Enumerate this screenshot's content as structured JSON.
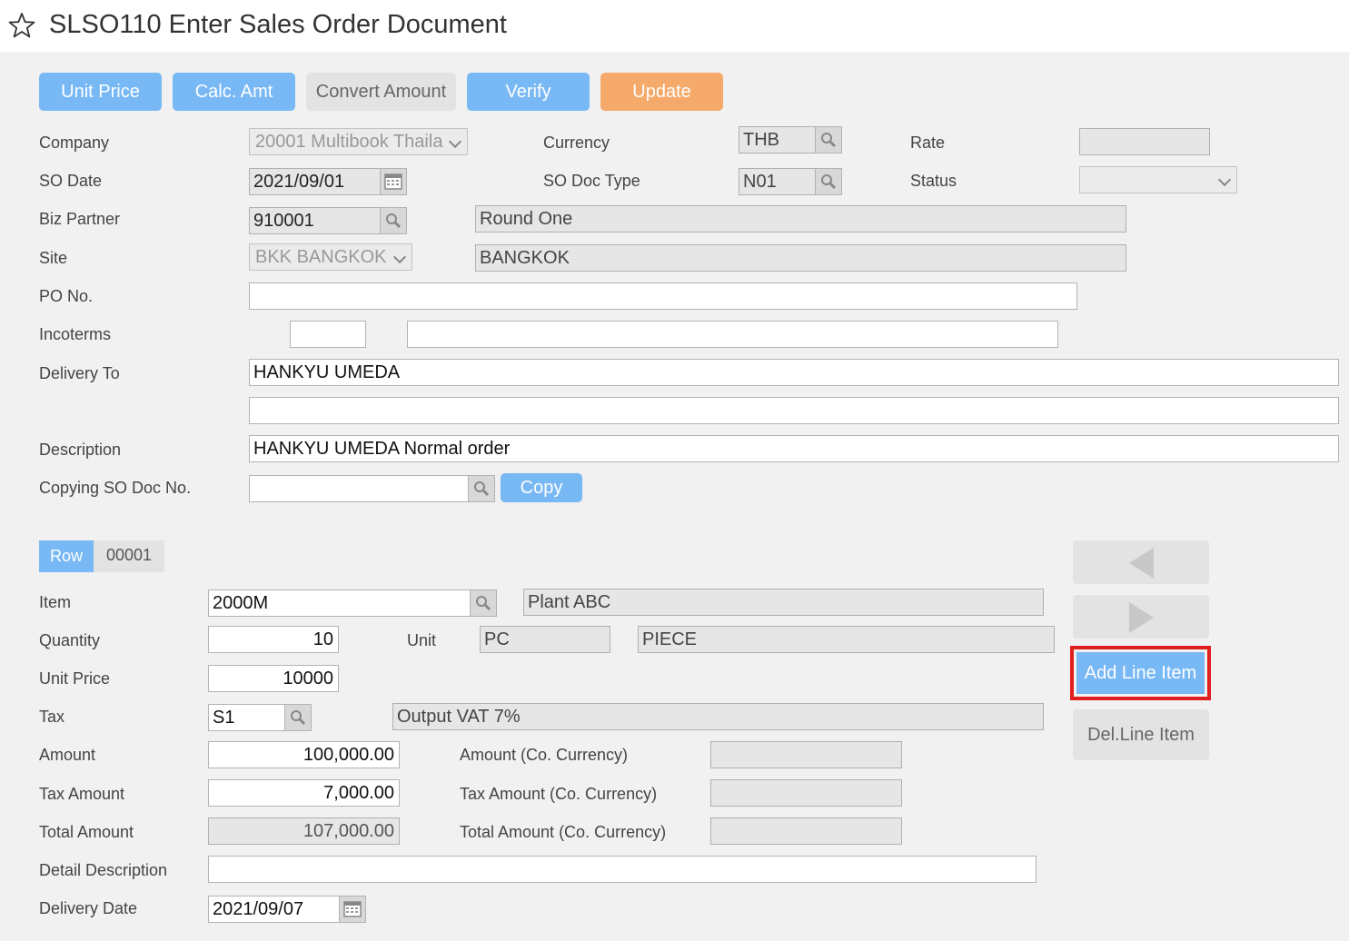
{
  "window": {
    "title": "SLSO110 Enter Sales Order Document"
  },
  "toolbar": {
    "unit_price": "Unit Price",
    "calc_amt": "Calc. Amt",
    "convert_amount": "Convert Amount",
    "verify": "Verify",
    "update": "Update"
  },
  "header": {
    "company": {
      "label": "Company",
      "value": "20001 Multibook Thaila"
    },
    "currency": {
      "label": "Currency",
      "value": "THB"
    },
    "rate": {
      "label": "Rate",
      "value": ""
    },
    "so_date": {
      "label": "SO Date",
      "value": "2021/09/01"
    },
    "so_doc_type": {
      "label": "SO Doc Type",
      "value": "N01"
    },
    "status": {
      "label": "Status",
      "value": ""
    },
    "biz_partner": {
      "label": "Biz Partner",
      "value": "910001",
      "name": "Round One"
    },
    "site": {
      "label": "Site",
      "value": "BKK BANGKOK",
      "name": "BANGKOK"
    },
    "po_no": {
      "label": "PO No.",
      "value": ""
    },
    "incoterms": {
      "label": "Incoterms",
      "code": "",
      "desc": ""
    },
    "delivery_to": {
      "label": "Delivery To",
      "line1": "HANKYU UMEDA",
      "line2": ""
    },
    "description": {
      "label": "Description",
      "value": "HANKYU UMEDA Normal order"
    },
    "copying_so": {
      "label": "Copying SO Doc No.",
      "value": "",
      "copy_label": "Copy"
    }
  },
  "line": {
    "row_tab": "Row",
    "row_no": "00001",
    "item": {
      "label": "Item",
      "value": "2000M",
      "name": "Plant ABC"
    },
    "quantity": {
      "label": "Quantity",
      "value": "10"
    },
    "unit": {
      "label": "Unit",
      "code": "PC",
      "name": "PIECE"
    },
    "unit_price": {
      "label": "Unit Price",
      "value": "10000"
    },
    "tax": {
      "label": "Tax",
      "code": "S1",
      "name": "Output VAT 7%"
    },
    "amount": {
      "label": "Amount",
      "value": "100,000.00"
    },
    "amount_co": {
      "label": "Amount (Co. Currency)",
      "value": ""
    },
    "tax_amount": {
      "label": "Tax Amount",
      "value": "7,000.00"
    },
    "tax_amount_co": {
      "label": "Tax Amount (Co. Currency)",
      "value": ""
    },
    "total_amount": {
      "label": "Total Amount",
      "value": "107,000.00"
    },
    "total_amount_co": {
      "label": "Total Amount (Co. Currency)",
      "value": ""
    },
    "detail_description": {
      "label": "Detail Description",
      "value": ""
    },
    "delivery_date": {
      "label": "Delivery Date",
      "value": "2021/09/07"
    }
  },
  "side": {
    "add_line_item": "Add Line Item",
    "del_line_item": "Del.Line Item"
  },
  "colors": {
    "primary": "#78b8f4",
    "update": "#f5aa6c",
    "highlight": "#e0201e"
  }
}
